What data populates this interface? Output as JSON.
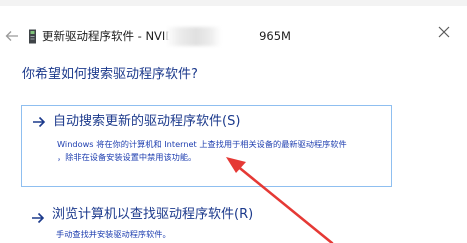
{
  "window": {
    "title": "更新驱动程序软件 - NVIDIA Ge",
    "title_suffix": "965M",
    "back_icon": "back-arrow-icon",
    "close_icon": "close-icon",
    "device_icon": "display-adapter-icon"
  },
  "main": {
    "heading": "你希望如何搜索驱动程序软件?",
    "options": [
      {
        "title": "自动搜索更新的驱动程序软件(S)",
        "description_line1": "Windows 将在你的计算机和 Internet 上查找用于相关设备的最新驱动程序软件",
        "description_line2": "，除非在设备安装设置中禁用该功能。",
        "icon": "arrow-right-icon"
      },
      {
        "title": "浏览计算机以查找驱动程序软件(R)",
        "description": "手动查找并安装驱动程序软件。",
        "icon": "arrow-right-icon"
      }
    ]
  },
  "annotation": {
    "color": "#e53935"
  }
}
